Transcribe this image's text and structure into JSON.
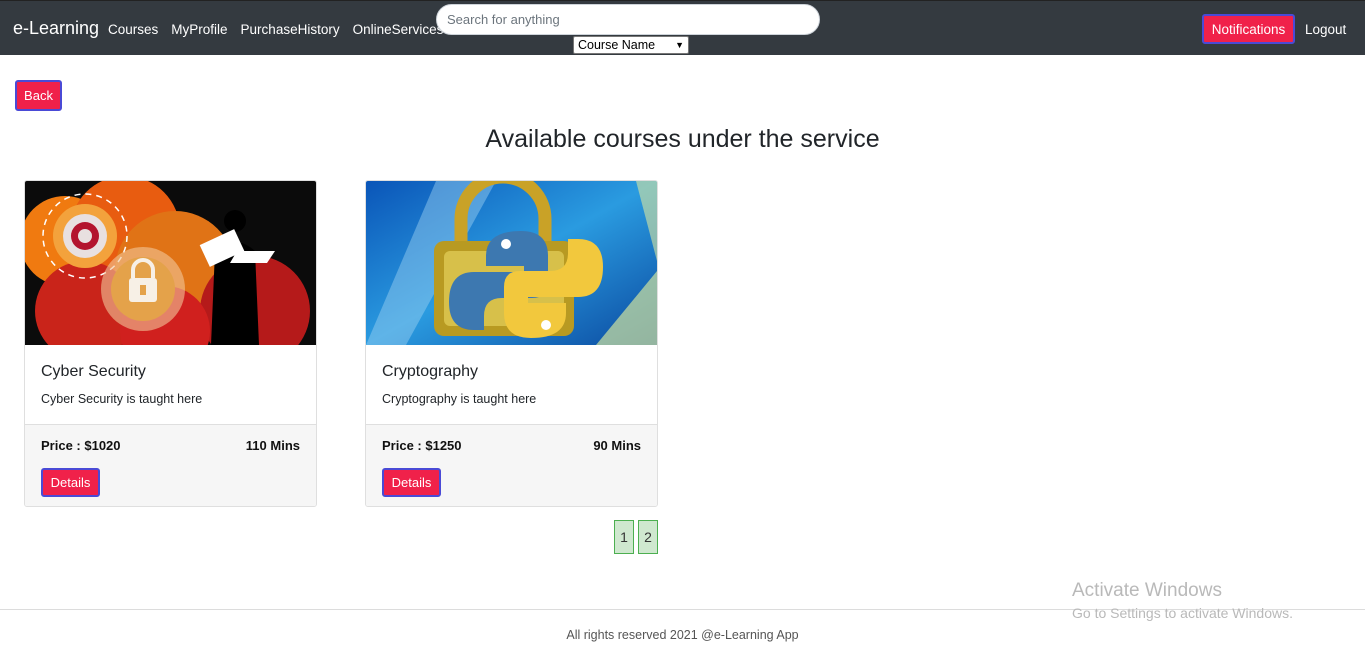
{
  "navbar": {
    "brand": "e-Learning",
    "links": [
      "Courses",
      "MyProfile",
      "PurchaseHistory",
      "OnlineServices"
    ],
    "search_placeholder": "Search for anything",
    "search_value": "",
    "filter_selected": "Course Name",
    "notifications_label": "Notifications",
    "logout_label": "Logout",
    "accent_color": "#f0214a",
    "bg_color": "#343a40"
  },
  "back_label": "Back",
  "page_title": "Available courses under the service",
  "courses": [
    {
      "title": "Cyber Security",
      "description": "Cyber Security is taught here",
      "price": "Price : $1020",
      "duration": "110 Mins",
      "details_label": "Details",
      "image_icon": "cyber-security-lock-image"
    },
    {
      "title": "Cryptography",
      "description": "Cryptography is taught here",
      "price": "Price : $1250",
      "duration": "90 Mins",
      "details_label": "Details",
      "image_icon": "padlock-python-image"
    }
  ],
  "pagination": [
    "1",
    "2"
  ],
  "watermark": {
    "line1": "Activate Windows",
    "line2": "Go to Settings to activate Windows."
  },
  "footer": "All rights reserved 2021 @e-Learning App"
}
